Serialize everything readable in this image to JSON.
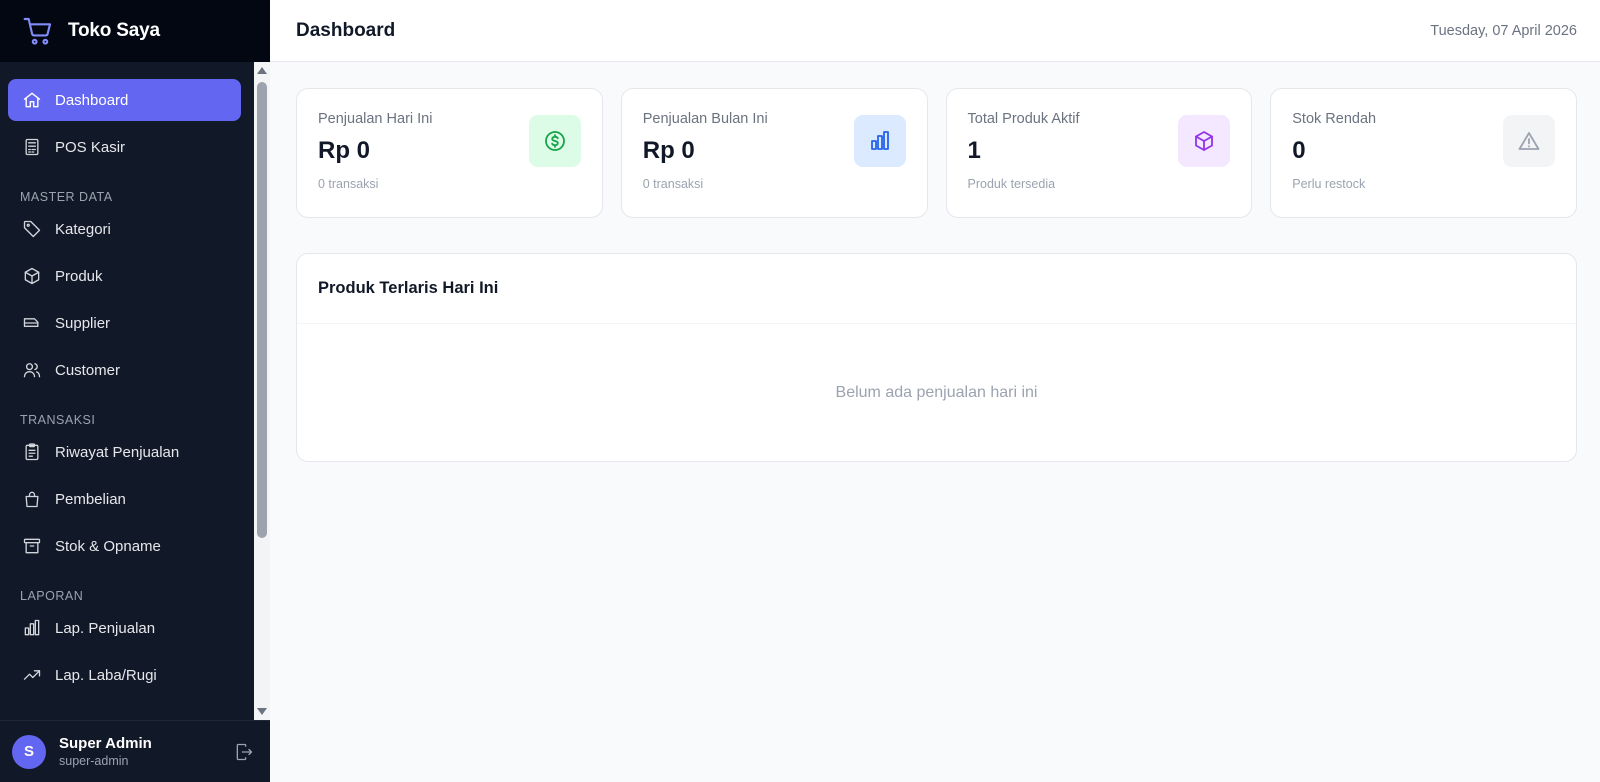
{
  "brand": {
    "name": "Toko Saya",
    "icon": "cart-icon",
    "accent": "#6366f1"
  },
  "nav": {
    "items_top": [
      {
        "label": "Dashboard",
        "icon": "home-icon",
        "active": true
      },
      {
        "label": "POS Kasir",
        "icon": "receipt-icon"
      }
    ],
    "sections": [
      {
        "title": "MASTER DATA",
        "items": [
          {
            "label": "Kategori",
            "icon": "tag-icon"
          },
          {
            "label": "Produk",
            "icon": "cube-icon"
          },
          {
            "label": "Supplier",
            "icon": "truck-icon"
          },
          {
            "label": "Customer",
            "icon": "users-icon"
          }
        ]
      },
      {
        "title": "TRANSAKSI",
        "items": [
          {
            "label": "Riwayat Penjualan",
            "icon": "clipboard-icon"
          },
          {
            "label": "Pembelian",
            "icon": "shopping-bag-icon"
          },
          {
            "label": "Stok & Opname",
            "icon": "archive-icon"
          }
        ]
      },
      {
        "title": "LAPORAN",
        "items": [
          {
            "label": "Lap. Penjualan",
            "icon": "bar-chart-icon"
          },
          {
            "label": "Lap. Laba/Rugi",
            "icon": "trending-up-icon"
          }
        ]
      }
    ]
  },
  "user": {
    "initial": "S",
    "name": "Super Admin",
    "role": "super-admin"
  },
  "header": {
    "title": "Dashboard",
    "date": "Tuesday, 07 April 2026"
  },
  "stats": [
    {
      "label": "Penjualan Hari Ini",
      "value": "Rp 0",
      "sub": "0 transaksi",
      "icon": "dollar-icon",
      "color": "#16a34a",
      "bg": "#dcfce7"
    },
    {
      "label": "Penjualan Bulan Ini",
      "value": "Rp 0",
      "sub": "0 transaksi",
      "icon": "bar-chart-icon",
      "color": "#2563eb",
      "bg": "#dbeafe"
    },
    {
      "label": "Total Produk Aktif",
      "value": "1",
      "sub": "Produk tersedia",
      "icon": "cube-icon",
      "color": "#9333ea",
      "bg": "#f3e8ff"
    },
    {
      "label": "Stok Rendah",
      "value": "0",
      "sub": "Perlu restock",
      "icon": "warning-icon",
      "color": "#9ca3af",
      "bg": "#f3f4f6"
    }
  ],
  "best_sellers": {
    "title": "Produk Terlaris Hari Ini",
    "empty_text": "Belum ada penjualan hari ini"
  }
}
